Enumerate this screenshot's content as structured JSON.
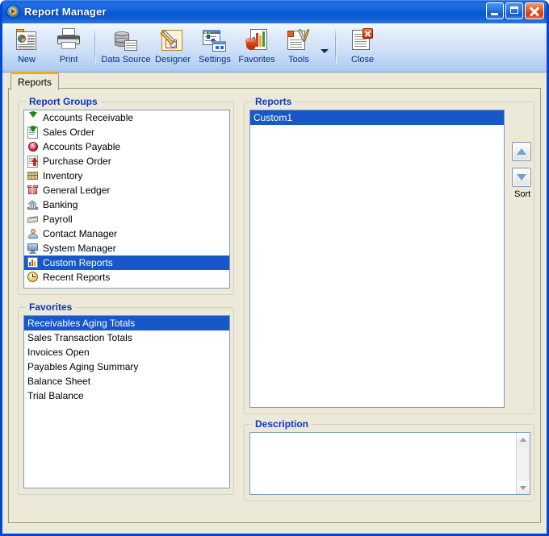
{
  "window": {
    "title": "Report Manager",
    "icon": "app-icon",
    "controls": {
      "minimize": "Minimize",
      "maximize": "Maximize",
      "close": "Close"
    }
  },
  "toolbar": {
    "items": [
      {
        "label": "New",
        "icon": "new-report-icon"
      },
      {
        "label": "Print",
        "icon": "printer-icon"
      },
      {
        "label": "Data Source",
        "icon": "database-icon"
      },
      {
        "label": "Designer",
        "icon": "designer-icon"
      },
      {
        "label": "Settings",
        "icon": "settings-icon"
      },
      {
        "label": "Favorites",
        "icon": "favorites-icon"
      },
      {
        "label": "Tools",
        "icon": "tools-icon"
      },
      {
        "label": "Close",
        "icon": "close-report-icon"
      }
    ],
    "overflow_icon": "chevron-down-icon"
  },
  "tabs": [
    {
      "label": "Reports",
      "active": true
    }
  ],
  "report_groups": {
    "title": "Report Groups",
    "items": [
      {
        "label": "Accounts Receivable",
        "icon": "green-down-arrow-icon",
        "selected": false
      },
      {
        "label": "Sales Order",
        "icon": "sales-order-icon",
        "selected": false
      },
      {
        "label": "Accounts Payable",
        "icon": "red-coin-icon",
        "selected": false
      },
      {
        "label": "Purchase Order",
        "icon": "purchase-order-icon",
        "selected": false
      },
      {
        "label": "Inventory",
        "icon": "inventory-boxes-icon",
        "selected": false
      },
      {
        "label": "General Ledger",
        "icon": "general-ledger-icon",
        "selected": false
      },
      {
        "label": "Banking",
        "icon": "bank-building-icon",
        "selected": false
      },
      {
        "label": "Payroll",
        "icon": "payroll-check-icon",
        "selected": false
      },
      {
        "label": "Contact Manager",
        "icon": "contact-person-icon",
        "selected": false
      },
      {
        "label": "System Manager",
        "icon": "monitor-icon",
        "selected": false
      },
      {
        "label": "Custom Reports",
        "icon": "bar-chart-page-icon",
        "selected": true
      },
      {
        "label": "Recent Reports",
        "icon": "clock-icon",
        "selected": false
      }
    ]
  },
  "favorites": {
    "title": "Favorites",
    "items": [
      {
        "label": "Receivables Aging Totals",
        "selected": true
      },
      {
        "label": "Sales Transaction Totals",
        "selected": false
      },
      {
        "label": "Invoices Open",
        "selected": false
      },
      {
        "label": "Payables Aging Summary",
        "selected": false
      },
      {
        "label": "Balance Sheet",
        "selected": false
      },
      {
        "label": "Trial Balance",
        "selected": false
      }
    ]
  },
  "reports": {
    "title": "Reports",
    "items": [
      {
        "label": "Custom1",
        "selected": true
      }
    ],
    "sort": {
      "label": "Sort",
      "up_icon": "sort-up-arrow-icon",
      "down_icon": "sort-down-arrow-icon"
    }
  },
  "description": {
    "title": "Description",
    "value": "",
    "scrollbar": {
      "up_icon": "scroll-up-arrow-icon",
      "down_icon": "scroll-down-arrow-icon"
    }
  },
  "colors": {
    "titlebar_blue": "#1260dd",
    "window_border": "#0046d5",
    "selection_blue": "#1658c8",
    "group_title_blue": "#0a37c4",
    "toolbar_label_blue": "#00308f",
    "face": "#ece9d8",
    "active_tab_accent": "#f0a826"
  }
}
